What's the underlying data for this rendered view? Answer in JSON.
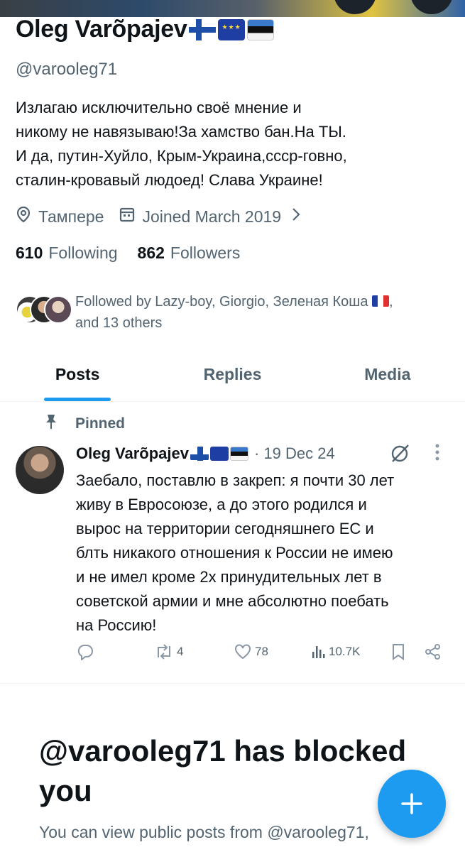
{
  "profile": {
    "name": "Oleg Varõpajev",
    "handle": "@varooleg71",
    "bio_lines": [
      "Излагаю исключительно своё мнение и",
      "никому не навязываю!За хамство бан.На ТЫ.",
      "И да, путин-Хуйло, Крым-Украина,ссср-говно,",
      "сталин-кровавый людоед! Слава Украине!"
    ],
    "location": "Тампере",
    "joined": "Joined March 2019",
    "following_count": "610",
    "following_label": "Following",
    "followers_count": "862",
    "followers_label": "Followers",
    "followed_by_line1": "Followed by Lazy-boy, Giorgio, Зеленая Коша",
    "followed_by_line2": "and 13 others",
    "flags": [
      "finland-flag",
      "eu-flag",
      "estonia-flag"
    ]
  },
  "tabs": [
    {
      "label": "Posts",
      "active": true
    },
    {
      "label": "Replies",
      "active": false
    },
    {
      "label": "Media",
      "active": false
    }
  ],
  "pinned_tweet": {
    "pinned_label": "Pinned",
    "author": "Oleg Varõpajev",
    "date": "· 19 Dec 24",
    "text_lines": [
      "Заебало, поставлю в закреп: я почти 30 лет",
      "живу в Евросоюзе, а до этого родился и",
      "вырос на территории сегодняшнего ЕС и",
      "блть никакого отношения к России не имею",
      "и не имел кроме 2х принудительных лет в",
      "советской армии и мне абсолютно поебать",
      "на Россию!"
    ],
    "retweets": "4",
    "likes": "78",
    "views": "10.7K"
  },
  "blocked": {
    "title": "@varooleg71 has blocked you",
    "subtitle": "You can view public posts from @varooleg71,"
  },
  "colors": {
    "accent": "#1d9bf0",
    "text_primary": "#0f1419",
    "text_secondary": "#536471"
  }
}
